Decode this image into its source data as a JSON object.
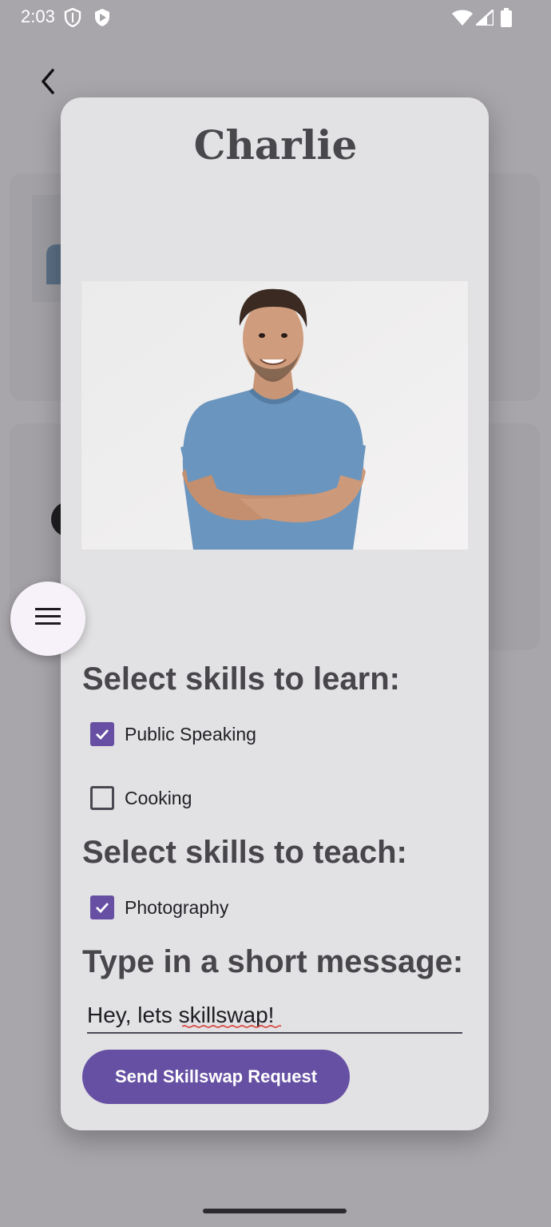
{
  "status_bar": {
    "time": "2:03",
    "icons": [
      "shield-icon",
      "play-protect-icon",
      "wifi-icon",
      "signal-icon",
      "battery-icon"
    ]
  },
  "background": {
    "back_icon": "chevron-left-icon"
  },
  "dialog": {
    "title": "Charlie",
    "photo_alt": "Smiling man in blue t-shirt with arms crossed",
    "learn_heading": "Select skills to learn:",
    "learn_skills": [
      {
        "label": "Public Speaking",
        "checked": true
      },
      {
        "label": "Cooking",
        "checked": false
      }
    ],
    "teach_heading": "Select skills to teach:",
    "teach_skills": [
      {
        "label": "Photography",
        "checked": true
      }
    ],
    "message_heading": "Type in a short message:",
    "message_value": "Hey, lets skillswap!",
    "send_button": "Send Skillswap Request"
  },
  "fab": {
    "icon": "menu-icon"
  },
  "colors": {
    "accent": "#6750a4",
    "scrim": "#a9a6ab",
    "dialog_bg": "#e2e1e3",
    "fab_bg": "#f7f2fa"
  }
}
